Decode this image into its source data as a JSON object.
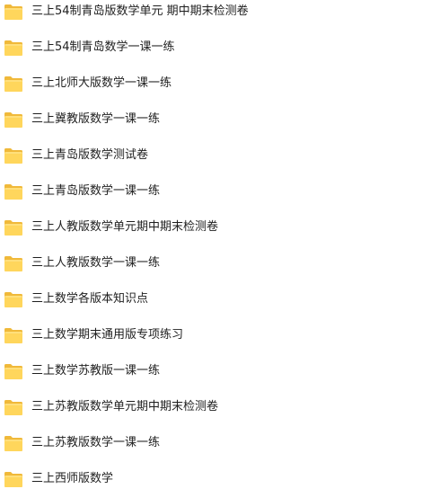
{
  "folders": [
    {
      "name": "三上54制青岛版数学单元 期中期末检测卷"
    },
    {
      "name": "三上54制青岛数学一课一练"
    },
    {
      "name": "三上北师大版数学一课一练"
    },
    {
      "name": "三上冀教版数学一课一练"
    },
    {
      "name": "三上青岛版数学测试卷"
    },
    {
      "name": "三上青岛版数学一课一练"
    },
    {
      "name": "三上人教版数学单元期中期末检测卷"
    },
    {
      "name": "三上人教版数学一课一练"
    },
    {
      "name": "三上数学各版本知识点"
    },
    {
      "name": "三上数学期末通用版专项练习"
    },
    {
      "name": "三上数学苏教版一课一练"
    },
    {
      "name": "三上苏教版数学单元期中期末检测卷"
    },
    {
      "name": "三上苏教版数学一课一练"
    },
    {
      "name": "三上西师版数学"
    }
  ],
  "colors": {
    "folder_back": "#f0b93a",
    "folder_front": "#ffd65c",
    "text": "#1f1f1f"
  },
  "icon": "folder-icon"
}
